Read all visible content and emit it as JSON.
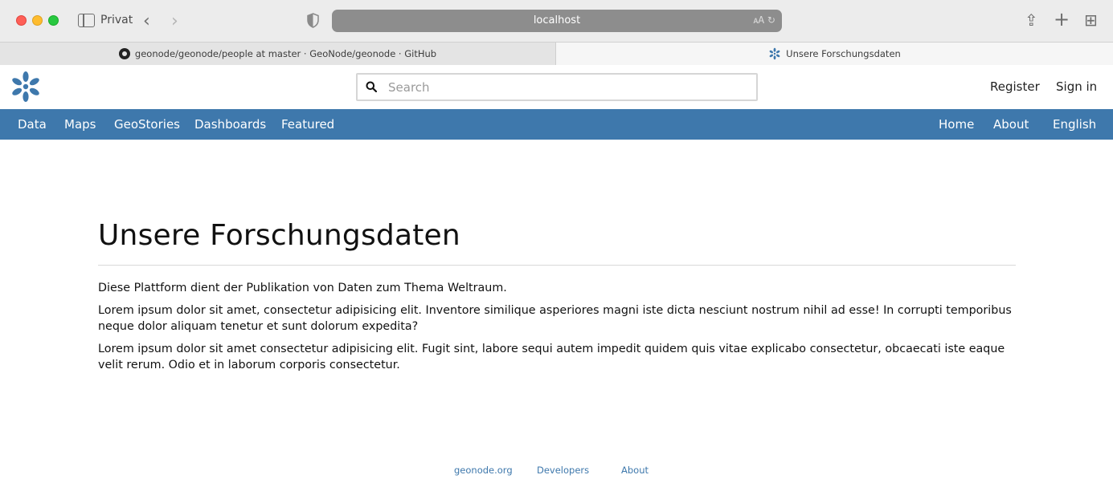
{
  "browser": {
    "profile_label": "Privat",
    "url": "localhost",
    "tabs": [
      {
        "label": "geonode/geonode/people at master · GeoNode/geonode · GitHub",
        "active": false
      },
      {
        "label": "Unsere Forschungsdaten",
        "active": true
      }
    ]
  },
  "header": {
    "search_placeholder": "Search",
    "register_label": "Register",
    "signin_label": "Sign in"
  },
  "nav": {
    "left": [
      "Data",
      "Maps",
      "GeoStories",
      "Dashboards",
      "Featured"
    ],
    "right": [
      "Home",
      "About",
      "English"
    ]
  },
  "main": {
    "title": "Unsere Forschungsdaten",
    "paragraphs": [
      "Diese Plattform dient der Publikation von Daten zum Thema Weltraum.",
      "Lorem ipsum dolor sit amet, consectetur adipisicing elit. Inventore similique asperiores magni iste dicta nesciunt nostrum nihil ad esse! In corrupti temporibus neque dolor aliquam tenetur et sunt dolorum expedita?",
      "Lorem ipsum dolor sit amet consectetur adipisicing elit. Fugit sint, labore sequi autem impedit quidem quis vitae explicabo consectetur, obcaecati iste eaque velit rerum. Odio et in laborum corporis consectetur."
    ]
  },
  "footer": {
    "links": [
      "geonode.org",
      "Developers",
      "About"
    ]
  },
  "colors": {
    "nav_background": "#3e78ac",
    "link": "#3e78ac",
    "url_bar": "#8d8d8d"
  }
}
